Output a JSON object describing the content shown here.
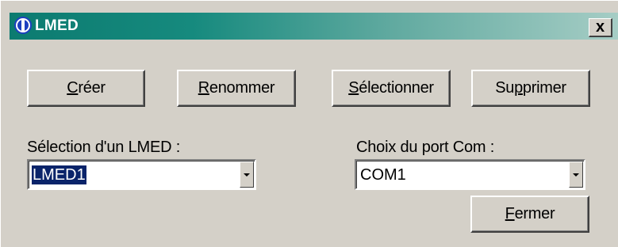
{
  "window": {
    "title": "LMED",
    "close_label": "x"
  },
  "buttons": {
    "creer": {
      "pre": "",
      "mnemonic": "C",
      "post": "réer"
    },
    "renommer": {
      "pre": "",
      "mnemonic": "R",
      "post": "enommer"
    },
    "selectionner": {
      "pre": "",
      "mnemonic": "S",
      "post": "électionner"
    },
    "supprimer": {
      "pre": "Su",
      "mnemonic": "p",
      "post": "primer"
    },
    "fermer": {
      "pre": "",
      "mnemonic": "F",
      "post": "ermer"
    }
  },
  "lmed": {
    "label": "Sélection d'un LMED :",
    "value": "LMED1"
  },
  "port": {
    "label": "Choix du port Com :",
    "value": "COM1"
  },
  "icons": {
    "app": "app-logo-icon",
    "close": "close-icon",
    "dropdown": "dropdown-arrow-icon"
  },
  "colors": {
    "title_gradient_start": "#0c7b70",
    "title_gradient_end": "#a6cdc5",
    "selection_highlight": "#0a246a",
    "face": "#d4d0c8"
  }
}
